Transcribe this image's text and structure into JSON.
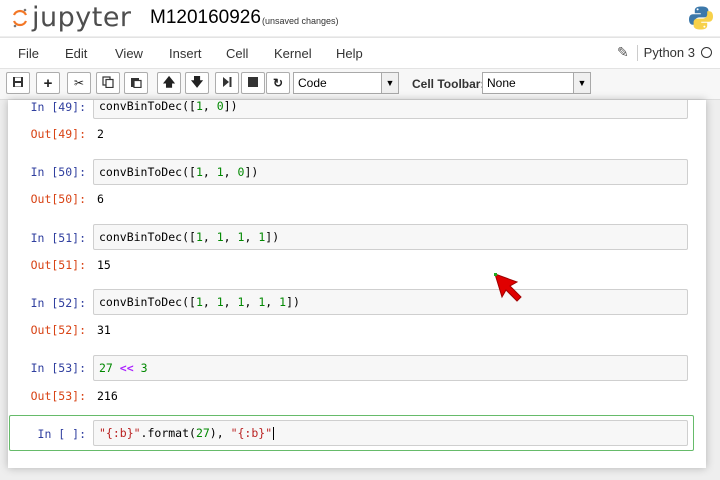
{
  "header": {
    "logo_text": "jupyter",
    "notebook_name": "M120160926",
    "save_status": "(unsaved changes)"
  },
  "menubar": {
    "items": [
      "File",
      "Edit",
      "View",
      "Insert",
      "Cell",
      "Kernel",
      "Help"
    ],
    "kernel_name": "Python 3"
  },
  "toolbar": {
    "buttons": [
      "save-icon",
      "plus-icon",
      "cut-icon",
      "copy-icon",
      "paste-icon",
      "arrow-up-icon",
      "arrow-down-icon",
      "step-forward-icon",
      "stop-icon",
      "restart-icon"
    ],
    "cell_type": "Code",
    "cell_toolbar_label": "Cell Toolbar:",
    "cell_toolbar_value": "None"
  },
  "cells": [
    {
      "in_prompt": "In [49]:",
      "code": "convBinToDec([1, 0])",
      "out_prompt": "Out[49]:",
      "output": "2"
    },
    {
      "in_prompt": "In [50]:",
      "code": "convBinToDec([1, 1, 0])",
      "out_prompt": "Out[50]:",
      "output": "6"
    },
    {
      "in_prompt": "In [51]:",
      "code": "convBinToDec([1, 1, 1, 1])",
      "out_prompt": "Out[51]:",
      "output": "15"
    },
    {
      "in_prompt": "In [52]:",
      "code": "convBinToDec([1, 1, 1, 1, 1])",
      "out_prompt": "Out[52]:",
      "output": "31"
    },
    {
      "in_prompt": "In [53]:",
      "code": "27 << 3",
      "out_prompt": "Out[53]:",
      "output": "216"
    },
    {
      "in_prompt": "In [ ]:",
      "code": "\"{:b}\".format(27), \"{:b}\""
    }
  ],
  "colors": {
    "in_prompt": "#303f9f",
    "out_prompt": "#d84315",
    "selected_border": "#66bb6a",
    "pointer": "#e00000"
  }
}
